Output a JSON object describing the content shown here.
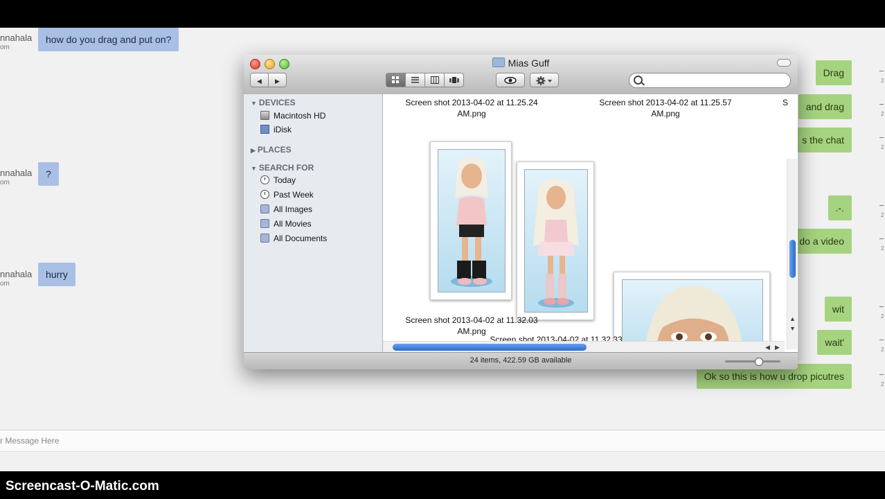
{
  "watermark": "Screencast-O-Matic.com",
  "chat": {
    "left_messages": [
      {
        "sender": "nnahala",
        "sub": "om",
        "text": "how do you drag and put on?"
      },
      {
        "sender": "nnahala",
        "sub": "om",
        "text": "?"
      },
      {
        "sender": "nnahala",
        "sub": "om",
        "text": "hurry"
      }
    ],
    "right_messages": [
      "Drag",
      "and drag",
      "s the chat",
      ".-.",
      "do a video",
      "wit",
      "wait'",
      "Ok so this is how u drop picutres"
    ],
    "timestamp_glyph": "2",
    "input_placeholder": "r Message Here"
  },
  "finder": {
    "title": "Mias Guff",
    "nav": {
      "back": "◀",
      "forward": "▶"
    },
    "view_modes": [
      "icon",
      "list",
      "column",
      "coverflow"
    ],
    "active_view": "icon",
    "search_value": "",
    "sidebar": {
      "devices_label": "DEVICES",
      "devices": [
        "Macintosh HD",
        "iDisk"
      ],
      "places_label": "PLACES",
      "search_label": "SEARCH FOR",
      "searches": [
        "Today",
        "Past Week",
        "All Images",
        "All Movies",
        "All Documents"
      ]
    },
    "files": [
      {
        "line1": "Screen shot 2013-04-02 at 11.25.24",
        "line2": "AM.png"
      },
      {
        "line1": "Screen shot 2013-04-02 at 11.25.57",
        "line2": "AM.png"
      },
      {
        "line1": "S",
        "line2": ""
      },
      {
        "line1": "Screen shot 2013-04-02 at 11.32.03",
        "line2": "AM.png"
      },
      {
        "line1": "Screen shot 2013-04-02 at 11.32.33",
        "line2": ""
      }
    ],
    "status": "24 items, 422.59 GB available",
    "zoom_level": 0.62
  },
  "colors": {
    "left_bubble": "#a9bfe4",
    "right_bubble": "#a6d37f",
    "accent_scroll": "#2d6ad1"
  }
}
